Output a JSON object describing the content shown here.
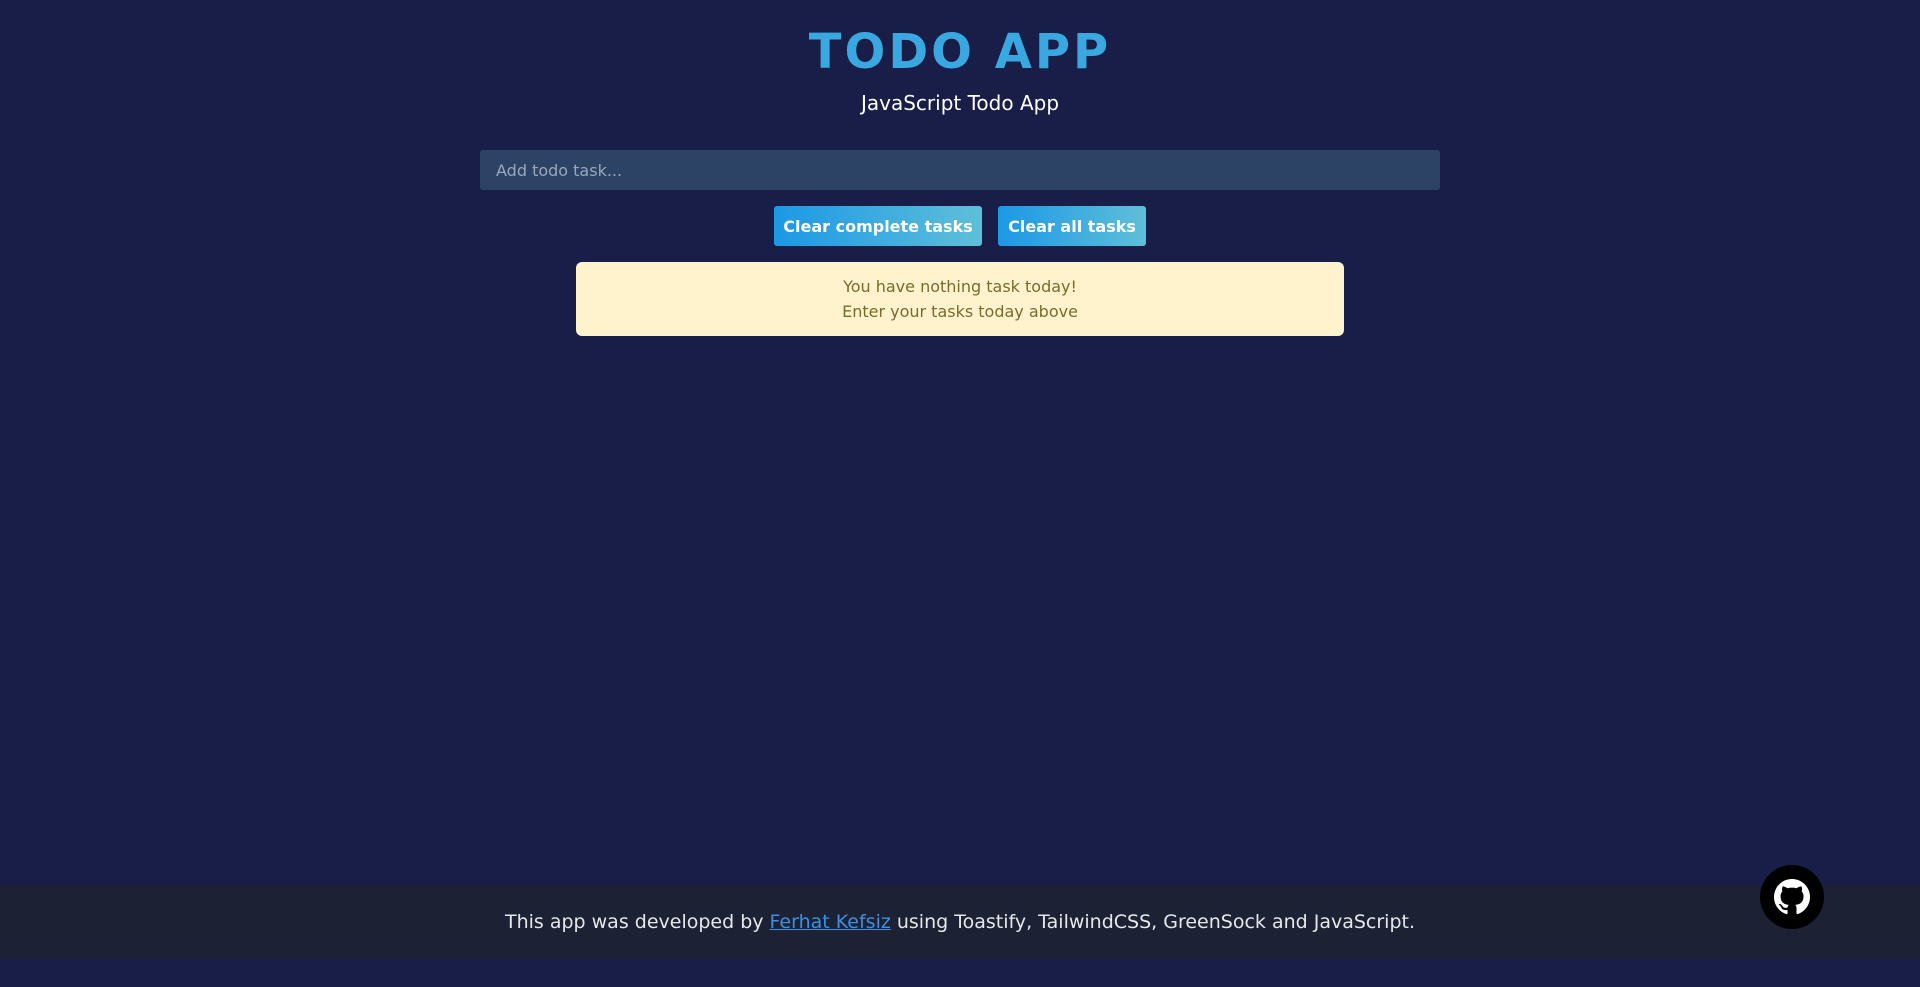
{
  "header": {
    "title": "TODO APP",
    "subtitle": "JavaScript Todo App"
  },
  "form": {
    "input_placeholder": "Add todo task...",
    "input_value": "",
    "clear_complete_label": "Clear complete tasks",
    "clear_all_label": "Clear all tasks"
  },
  "empty_state": {
    "line1": "You have nothing task today!",
    "line2": "Enter your tasks today above"
  },
  "footer": {
    "prefix": "This app was developed by ",
    "author_link": "Ferhat Kefsiz",
    "suffix": " using Toastify, TailwindCSS, GreenSock and JavaScript."
  },
  "icons": {
    "github": "github-icon"
  },
  "colors": {
    "background": "#181e48",
    "title": "#3aa8e0",
    "input_bg": "#2d4366",
    "button_gradient_start": "#1c98e6",
    "button_gradient_end": "#5fbfd8",
    "empty_bg": "#fff3cd",
    "empty_text": "#7a6a2c",
    "footer_bg": "#1c2233",
    "link": "#3b8fe6"
  }
}
